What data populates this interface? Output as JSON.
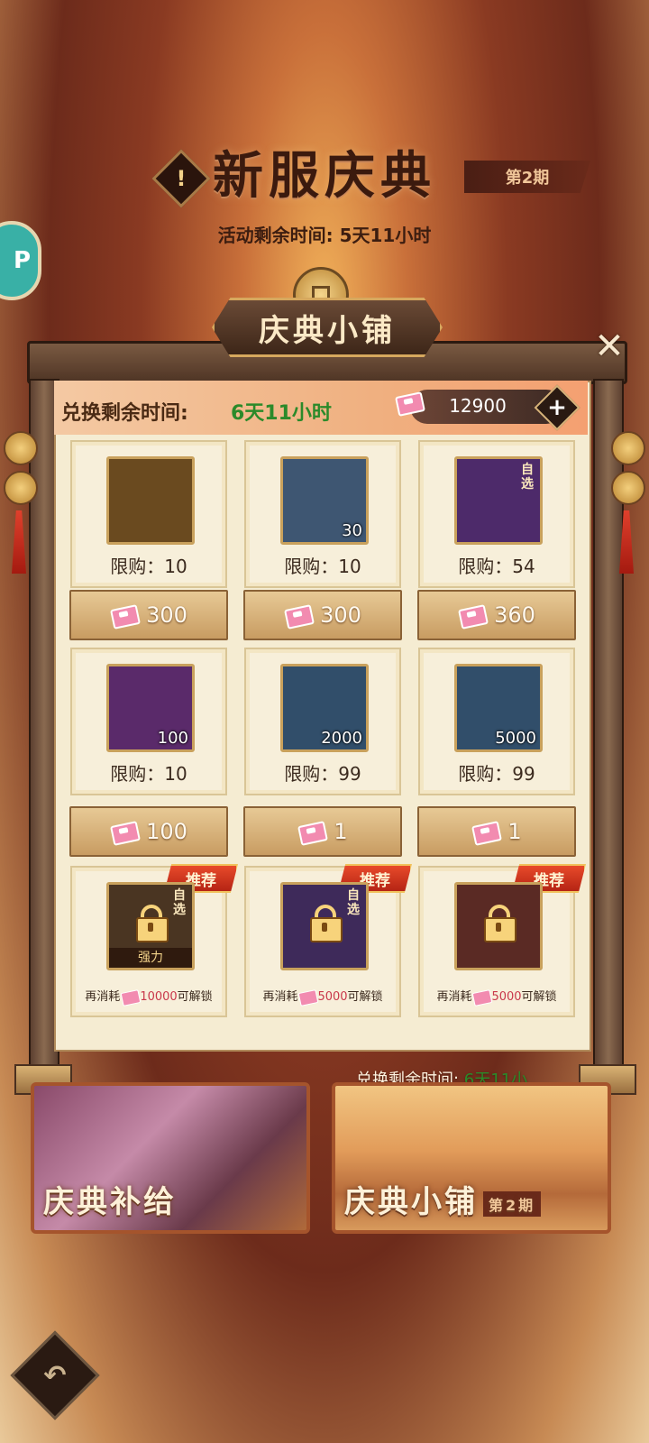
{
  "header": {
    "title": "新服庆典",
    "period_tag": "第2期",
    "remaining_label": "活动剩余时间: 5天11小时",
    "tip_icon": "!",
    "side_badge": "P"
  },
  "shop": {
    "title": "庆典小铺",
    "close_icon": "close-icon",
    "exchange_label": "兑换剩余时间: ",
    "exchange_value": "6天11小时",
    "currency_value": "12900",
    "plus": "+",
    "items": [
      {
        "icon": "green-swirl-orb-icon",
        "qty": "",
        "limit": "限购：10",
        "price": "300",
        "color": "#6a4a1f"
      },
      {
        "icon": "silver-shard-icon",
        "qty": "30",
        "limit": "限购：10",
        "price": "300",
        "color": "#3e5672"
      },
      {
        "icon": "shadow-character-icon",
        "qty": "",
        "limit": "限购：54",
        "price": "360",
        "color": "#4d2a6a",
        "corner": "自选"
      },
      {
        "icon": "pink-flame-icon",
        "qty": "100",
        "limit": "限购：10",
        "price": "100",
        "color": "#5a2a6a"
      },
      {
        "icon": "green-jade-orb-icon",
        "qty": "2000",
        "limit": "限购：99",
        "price": "1",
        "color": "#314e6a"
      },
      {
        "icon": "copper-coin-icon",
        "qty": "5000",
        "limit": "限购：99",
        "price": "1",
        "color": "#314e6a"
      }
    ],
    "locked_items": [
      {
        "tag": "推荐",
        "corner": "自选",
        "strong": "强力",
        "prefix": "再消耗",
        "amount": "10000",
        "suffix": "可解锁",
        "color": "#4a3522"
      },
      {
        "tag": "推荐",
        "corner": "自选",
        "strong": "",
        "prefix": "再消耗",
        "amount": "5000",
        "suffix": "可解锁",
        "color": "#3e2a5a"
      },
      {
        "tag": "推荐",
        "corner": "",
        "strong": "",
        "prefix": "再消耗",
        "amount": "5000",
        "suffix": "可解锁",
        "color": "#5a2a24"
      }
    ]
  },
  "bottom": {
    "hint_label": "兑换剩余时间: ",
    "hint_value": "6天11小",
    "left_card": "庆典补给",
    "right_card": "庆典小铺",
    "right_tag": "第2期"
  },
  "back_icon": "↶"
}
